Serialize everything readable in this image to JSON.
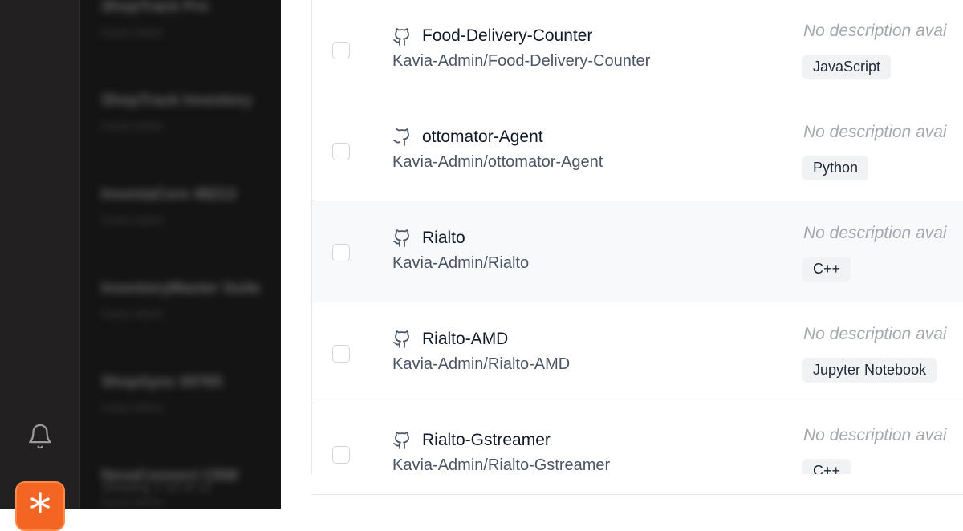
{
  "sidebar": {
    "icons": [
      "bell-icon",
      "brand-logo-icon"
    ],
    "brand_color": "#f26522"
  },
  "background_list": {
    "items": [
      {
        "title": "ShopTrack Pro",
        "sub": "Kavia Admin"
      },
      {
        "title": "ShopTrack Inventory",
        "sub": "Kavia Admin"
      },
      {
        "title": "InventaCore 48213",
        "sub": "Kavia Admin"
      },
      {
        "title": "InventoryMaster Suite",
        "sub": "Kavia Admin"
      },
      {
        "title": "ShopSync 00765",
        "sub": "Kavia Admin"
      },
      {
        "title": "NexaConnect CRM",
        "sub": "Kavia Admin"
      }
    ],
    "footer": "Showing 1-10 of 12"
  },
  "repos": [
    {
      "name": "Food-Delivery-Counter",
      "full_name": "Kavia-Admin/Food-Delivery-Counter",
      "description": "No description avai",
      "language": "JavaScript"
    },
    {
      "name": "ottomator-Agent",
      "full_name": "Kavia-Admin/ottomator-Agent",
      "description": "No description avai",
      "language": "Python"
    },
    {
      "name": "Rialto",
      "full_name": "Kavia-Admin/Rialto",
      "description": "No description avai",
      "language": "C++"
    },
    {
      "name": "Rialto-AMD",
      "full_name": "Kavia-Admin/Rialto-AMD",
      "description": "No description avai",
      "language": "Jupyter Notebook"
    },
    {
      "name": "Rialto-Gstreamer",
      "full_name": "Kavia-Admin/Rialto-Gstreamer",
      "description": "No description avai",
      "language": "C++"
    }
  ]
}
